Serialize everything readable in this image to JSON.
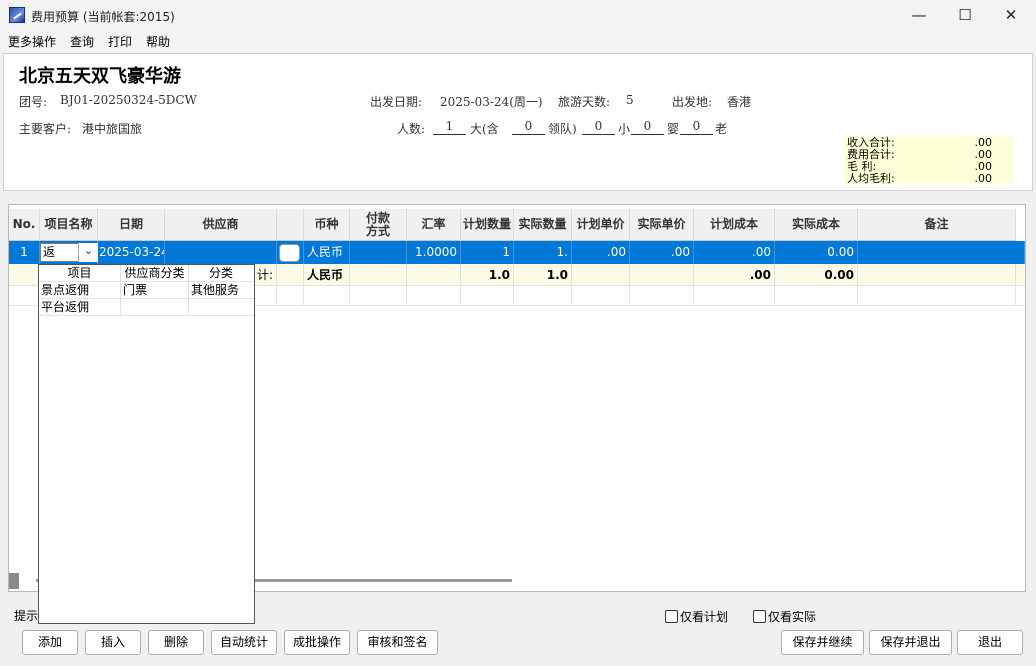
{
  "window": {
    "title": "费用预算 (当前帐套:2015)",
    "minimize_glyph": "—",
    "maximize_glyph": "☐",
    "close_glyph": "✕"
  },
  "menu": [
    "更多操作",
    "查询",
    "打印",
    "帮助"
  ],
  "header": {
    "tour_name": "北京五天双飞豪华游",
    "group_label": "团号:",
    "group_no": "BJ01-20250324-5DCW",
    "departure_date_label": "出发日期:",
    "departure_date": "2025-03-24(周一)",
    "days_label": "旅游天数:",
    "days": "5",
    "origin_label": "出发地:",
    "origin": "香港",
    "customer_label": "主要客户:",
    "customer": "港中旅国旅",
    "people_label": "人数:",
    "adults": "1",
    "adult_label": "大(含",
    "leaders": "0",
    "leader_label": "领队)",
    "children": "0",
    "child_label": "小",
    "infants": "0",
    "infant_label": "婴",
    "elders": "0",
    "elder_label": "老"
  },
  "summary": [
    {
      "label": "收入合计:",
      "value": ".00"
    },
    {
      "label": "费用合计:",
      "value": ".00"
    },
    {
      "label": "毛    利:",
      "value": ".00"
    },
    {
      "label": "人均毛利:",
      "value": ".00"
    }
  ],
  "grid": {
    "columns": [
      "No.",
      "项目名称",
      "日期",
      "供应商",
      "",
      "币种",
      "付款\n方式",
      "汇率",
      "计划数量",
      "实际数量",
      "计划单价",
      "实际单价",
      "计划成本",
      "实际成本",
      "备注"
    ],
    "row": {
      "no": "1",
      "item": "返",
      "date": "2025-03-24",
      "supplier": "",
      "currency": "人民币",
      "payment": "",
      "rate": "1.0000",
      "plan_qty": "1",
      "actual_qty": "1.",
      "plan_price": ".00",
      "actual_price": ".00",
      "plan_cost": ".00",
      "actual_cost": "0.00",
      "remark": ""
    },
    "total": {
      "label_suffix": "计:",
      "currency": "人民币",
      "plan_qty": "1.0",
      "actual_qty": "1.0",
      "plan_cost": ".00",
      "actual_cost": "0.00"
    }
  },
  "dropdown": {
    "headers": [
      "项目",
      "供应商分类",
      "分类"
    ],
    "rows": [
      [
        "景点返佣",
        "门票",
        "其他服务"
      ],
      [
        "平台返佣",
        "",
        ""
      ]
    ]
  },
  "footer": {
    "tip": "提示",
    "only_plan": "仅看计划",
    "only_actual": "仅看实际",
    "buttons_left": [
      "添加",
      "插入",
      "删除",
      "自动统计",
      "成批操作",
      "审核和签名"
    ],
    "buttons_right": [
      "保存并继续",
      "保存并退出",
      "退出"
    ]
  }
}
